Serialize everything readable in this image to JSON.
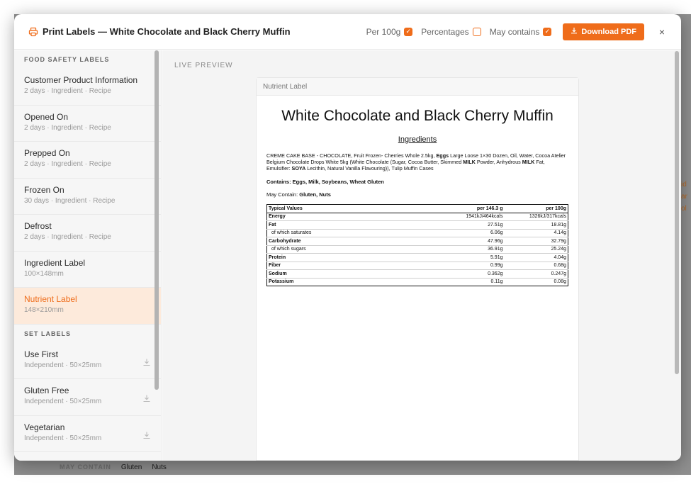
{
  "header": {
    "title": "Print Labels — White Chocolate and Black Cherry Muffin",
    "options": [
      {
        "label": "Per 100g",
        "checked": true
      },
      {
        "label": "Percentages",
        "checked": false
      },
      {
        "label": "May contains",
        "checked": true
      }
    ],
    "download_label": "Download PDF",
    "close_label": "×"
  },
  "sidebar": {
    "food_safety_heading": "FOOD SAFETY LABELS",
    "food_safety_items": [
      {
        "name": "Customer Product Information",
        "sub": "2 days · Ingredient · Recipe"
      },
      {
        "name": "Opened On",
        "sub": "2 days · Ingredient · Recipe"
      },
      {
        "name": "Prepped On",
        "sub": "2 days · Ingredient · Recipe"
      },
      {
        "name": "Frozen On",
        "sub": "30 days · Ingredient · Recipe"
      },
      {
        "name": "Defrost",
        "sub": "2 days · Ingredient · Recipe"
      },
      {
        "name": "Ingredient Label",
        "sub": "100×148mm"
      },
      {
        "name": "Nutrient Label",
        "sub": "148×210mm",
        "active": true
      }
    ],
    "set_heading": "SET LABELS",
    "set_items": [
      {
        "name": "Use First",
        "sub": "Independent · 50×25mm"
      },
      {
        "name": "Gluten Free",
        "sub": "Independent · 50×25mm"
      },
      {
        "name": "Vegetarian",
        "sub": "Independent · 50×25mm"
      }
    ]
  },
  "main": {
    "live_preview": "LIVE PREVIEW",
    "card_header": "Nutrient Label"
  },
  "label": {
    "title": "White Chocolate and Black Cherry Muffin",
    "ingredients_heading": "Ingredients",
    "ingredients_parts": [
      {
        "t": "CREME CAKE BASE - CHOCOLATE, Fruit Frozen- Cherries Whole 2.5kg, ",
        "b": false
      },
      {
        "t": "Eggs",
        "b": true
      },
      {
        "t": " Large Loose 1×30 Dozen, Oil, Water, Cocoa Atelier Belgium Chocolate Drops White 5kg (White Chocolate (Sugar, Cocoa Butter, Skimmed ",
        "b": false
      },
      {
        "t": "MILK",
        "b": true
      },
      {
        "t": " Powder, Anhydrous ",
        "b": false
      },
      {
        "t": "MILK",
        "b": true
      },
      {
        "t": " Fat, Emulsifier: ",
        "b": false
      },
      {
        "t": "SOYA",
        "b": true
      },
      {
        "t": " Lecithin, Natural Vanilla Flavouring)), Tulip Muffin Cases",
        "b": false
      }
    ],
    "contains": "Contains: Eggs, Milk, Soybeans, Wheat Gluten",
    "may_contain_prefix": "May Contain: ",
    "may_contain_value": "Gluten, Nuts",
    "table_headers": [
      "Typical Values",
      "per 146.3 g",
      "per 100g"
    ],
    "table_rows": [
      {
        "name": "Energy",
        "a": "1941kJ/464kcals",
        "b": "1326kJ/317kcals",
        "style": "bold"
      },
      {
        "name": "Fat",
        "a": "27.51g",
        "b": "18.81g",
        "style": "bold"
      },
      {
        "name": "of which saturates",
        "a": "6.06g",
        "b": "4.14g",
        "style": "sub"
      },
      {
        "name": "Carbohydrate",
        "a": "47.96g",
        "b": "32.79g",
        "style": "bold"
      },
      {
        "name": "of which sugars",
        "a": "36.91g",
        "b": "25.24g",
        "style": "sub"
      },
      {
        "name": "Protein",
        "a": "5.91g",
        "b": "4.04g",
        "style": "bold"
      },
      {
        "name": "Fiber",
        "a": "0.99g",
        "b": "0.68g",
        "style": "bold"
      },
      {
        "name": "Sodium",
        "a": "0.362g",
        "b": "0.247g",
        "style": "bold"
      },
      {
        "name": "Potassium",
        "a": "0.11g",
        "b": "0.08g",
        "style": "bold"
      }
    ]
  },
  "backdrop": {
    "may_contain_label": "MAY CONTAIN",
    "chips": [
      "Gluten",
      "Nuts"
    ],
    "edge_fragments": [
      "id",
      "ar",
      "ol"
    ]
  },
  "colors": {
    "accent": "#ef6c1a",
    "active_bg": "#fdeadb"
  }
}
